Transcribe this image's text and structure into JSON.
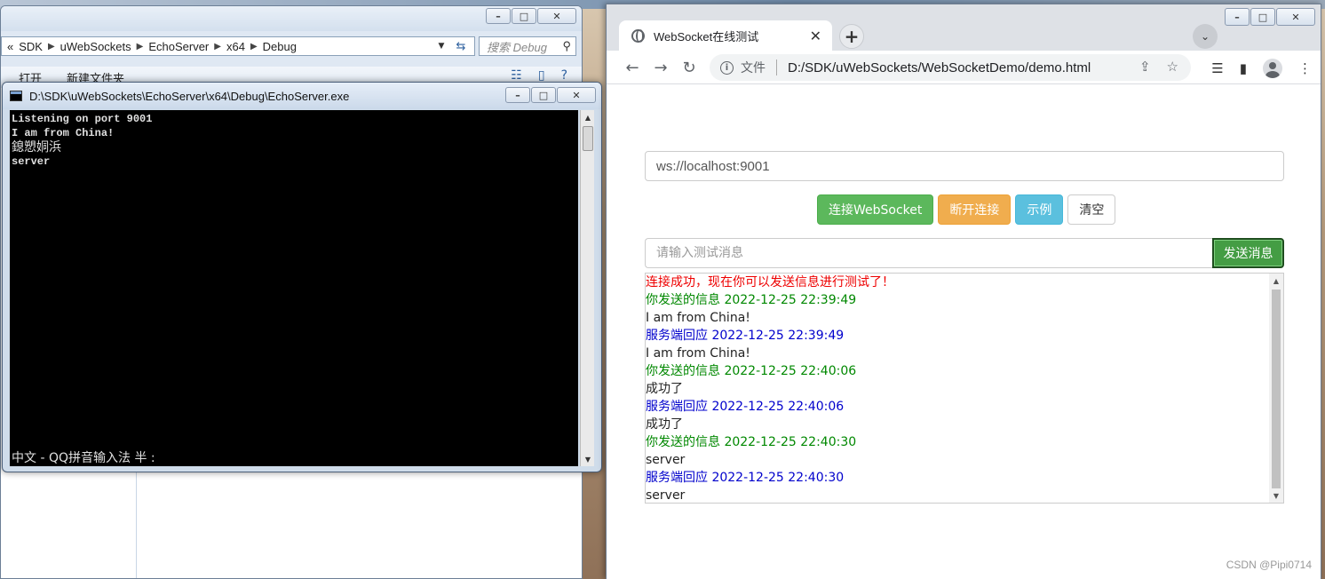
{
  "explorer": {
    "breadcrumb": [
      "SDK",
      "uWebSockets",
      "EchoServer",
      "x64",
      "Debug"
    ],
    "breadcrumb_prefix": "«",
    "search_placeholder": "搜索 Debug",
    "toolbar": {
      "open": "打开",
      "new_folder": "新建文件夹"
    }
  },
  "console": {
    "title": "D:\\SDK\\uWebSockets\\EchoServer\\x64\\Debug\\EchoServer.exe",
    "lines": [
      "Listening on port 9001",
      "I am from China!",
      "鎴愬姛浜",
      "server"
    ],
    "ime_status": "中文 - QQ拼音输入法 半 :"
  },
  "browser": {
    "tab_title": "WebSocket在线测试",
    "address": {
      "scheme_label": "文件",
      "url": "D:/SDK/uWebSockets/WebSocketDemo/demo.html"
    },
    "page": {
      "ws_url": "ws://localhost:9001",
      "buttons": {
        "connect": "连接WebSocket",
        "disconnect": "断开连接",
        "example": "示例",
        "clear": "清空"
      },
      "message_placeholder": "请输入测试消息",
      "send": "发送消息",
      "log": [
        {
          "text": "连接成功，现在你可以发送信息进行测试了！",
          "color": "red"
        },
        {
          "text": "你发送的信息 2022-12-25 22:39:49",
          "color": "green"
        },
        {
          "text": "I am from China!",
          "color": "black"
        },
        {
          "text": "服务端回应 2022-12-25 22:39:49",
          "color": "blue"
        },
        {
          "text": "I am from China!",
          "color": "black"
        },
        {
          "text": "你发送的信息 2022-12-25 22:40:06",
          "color": "green"
        },
        {
          "text": "成功了",
          "color": "black"
        },
        {
          "text": "服务端回应 2022-12-25 22:40:06",
          "color": "blue"
        },
        {
          "text": "成功了",
          "color": "black"
        },
        {
          "text": "你发送的信息 2022-12-25 22:40:30",
          "color": "green"
        },
        {
          "text": "server",
          "color": "black"
        },
        {
          "text": "服务端回应 2022-12-25 22:40:30",
          "color": "blue"
        },
        {
          "text": "server",
          "color": "black"
        }
      ]
    },
    "watermark": "CSDN @Pipi0714"
  },
  "colors": {
    "success": "#5cb85c",
    "warning": "#f0ad4e",
    "info": "#5bc0de",
    "send": "#449d44"
  }
}
